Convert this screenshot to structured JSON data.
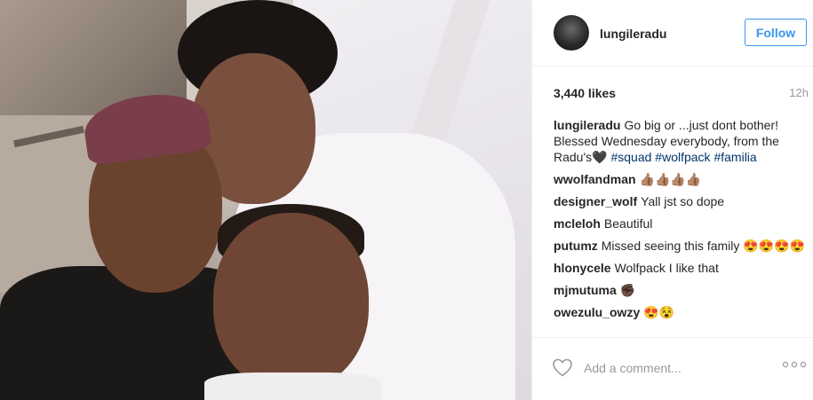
{
  "header": {
    "username": "lungileradu",
    "follow_label": "Follow"
  },
  "stats": {
    "likes": "3,440 likes",
    "time": "12h"
  },
  "caption": {
    "user": "lungileradu",
    "text": "Go big or ...just dont bother! Blessed Wednesday everybody, from the Radu's🖤 ",
    "tags": [
      "#squad",
      "#wolfpack",
      "#familia"
    ]
  },
  "comments": [
    {
      "user": "wwolfandman",
      "text": "👍🏽👍🏽👍🏽👍🏽"
    },
    {
      "user": "designer_wolf",
      "text": "Yall jst so dope"
    },
    {
      "user": "mcleloh",
      "text": "Beautiful"
    },
    {
      "user": "putumz",
      "text": "Missed seeing this family 😍😍😍😍"
    },
    {
      "user": "hlonycele",
      "text": "Wolfpack I like that"
    },
    {
      "user": "mjmutuma",
      "text": "✊🏿"
    },
    {
      "user": "owezulu_owzy",
      "text": "😍😵"
    }
  ],
  "footer": {
    "add_comment_placeholder": "Add a comment...",
    "heart_icon": "heart-outline-icon",
    "more_icon": "more-options-icon"
  },
  "colors": {
    "accent": "#3897f0",
    "hashtag": "#003569",
    "muted": "#999999",
    "border": "#efefef"
  }
}
